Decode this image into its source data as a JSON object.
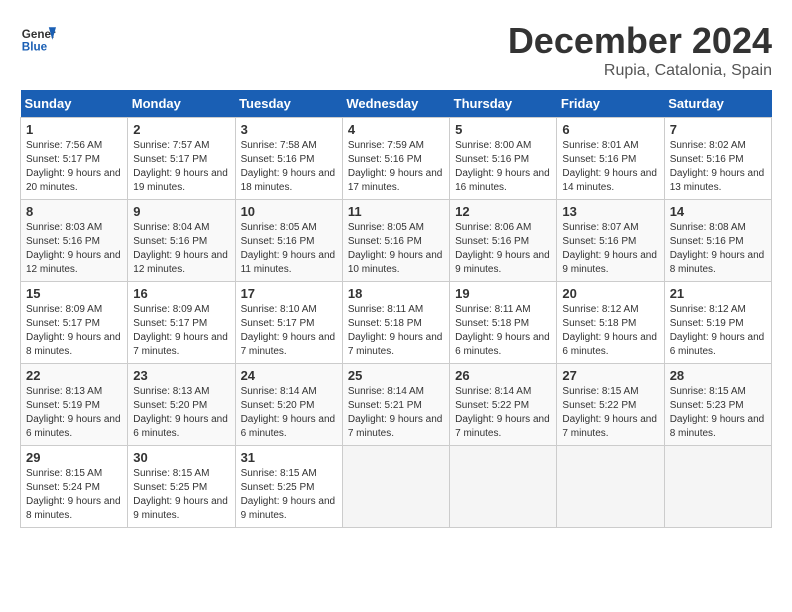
{
  "header": {
    "logo_line1": "General",
    "logo_line2": "Blue",
    "month": "December 2024",
    "location": "Rupia, Catalonia, Spain"
  },
  "weekdays": [
    "Sunday",
    "Monday",
    "Tuesday",
    "Wednesday",
    "Thursday",
    "Friday",
    "Saturday"
  ],
  "weeks": [
    [
      {
        "day": 1,
        "rise": "7:56 AM",
        "set": "5:17 PM",
        "daylight": "9 hours and 20 minutes"
      },
      {
        "day": 2,
        "rise": "7:57 AM",
        "set": "5:17 PM",
        "daylight": "9 hours and 19 minutes"
      },
      {
        "day": 3,
        "rise": "7:58 AM",
        "set": "5:16 PM",
        "daylight": "9 hours and 18 minutes"
      },
      {
        "day": 4,
        "rise": "7:59 AM",
        "set": "5:16 PM",
        "daylight": "9 hours and 17 minutes"
      },
      {
        "day": 5,
        "rise": "8:00 AM",
        "set": "5:16 PM",
        "daylight": "9 hours and 16 minutes"
      },
      {
        "day": 6,
        "rise": "8:01 AM",
        "set": "5:16 PM",
        "daylight": "9 hours and 14 minutes"
      },
      {
        "day": 7,
        "rise": "8:02 AM",
        "set": "5:16 PM",
        "daylight": "9 hours and 13 minutes"
      }
    ],
    [
      {
        "day": 8,
        "rise": "8:03 AM",
        "set": "5:16 PM",
        "daylight": "9 hours and 12 minutes"
      },
      {
        "day": 9,
        "rise": "8:04 AM",
        "set": "5:16 PM",
        "daylight": "9 hours and 12 minutes"
      },
      {
        "day": 10,
        "rise": "8:05 AM",
        "set": "5:16 PM",
        "daylight": "9 hours and 11 minutes"
      },
      {
        "day": 11,
        "rise": "8:05 AM",
        "set": "5:16 PM",
        "daylight": "9 hours and 10 minutes"
      },
      {
        "day": 12,
        "rise": "8:06 AM",
        "set": "5:16 PM",
        "daylight": "9 hours and 9 minutes"
      },
      {
        "day": 13,
        "rise": "8:07 AM",
        "set": "5:16 PM",
        "daylight": "9 hours and 9 minutes"
      },
      {
        "day": 14,
        "rise": "8:08 AM",
        "set": "5:16 PM",
        "daylight": "9 hours and 8 minutes"
      }
    ],
    [
      {
        "day": 15,
        "rise": "8:09 AM",
        "set": "5:17 PM",
        "daylight": "9 hours and 8 minutes"
      },
      {
        "day": 16,
        "rise": "8:09 AM",
        "set": "5:17 PM",
        "daylight": "9 hours and 7 minutes"
      },
      {
        "day": 17,
        "rise": "8:10 AM",
        "set": "5:17 PM",
        "daylight": "9 hours and 7 minutes"
      },
      {
        "day": 18,
        "rise": "8:11 AM",
        "set": "5:18 PM",
        "daylight": "9 hours and 7 minutes"
      },
      {
        "day": 19,
        "rise": "8:11 AM",
        "set": "5:18 PM",
        "daylight": "9 hours and 6 minutes"
      },
      {
        "day": 20,
        "rise": "8:12 AM",
        "set": "5:18 PM",
        "daylight": "9 hours and 6 minutes"
      },
      {
        "day": 21,
        "rise": "8:12 AM",
        "set": "5:19 PM",
        "daylight": "9 hours and 6 minutes"
      }
    ],
    [
      {
        "day": 22,
        "rise": "8:13 AM",
        "set": "5:19 PM",
        "daylight": "9 hours and 6 minutes"
      },
      {
        "day": 23,
        "rise": "8:13 AM",
        "set": "5:20 PM",
        "daylight": "9 hours and 6 minutes"
      },
      {
        "day": 24,
        "rise": "8:14 AM",
        "set": "5:20 PM",
        "daylight": "9 hours and 6 minutes"
      },
      {
        "day": 25,
        "rise": "8:14 AM",
        "set": "5:21 PM",
        "daylight": "9 hours and 7 minutes"
      },
      {
        "day": 26,
        "rise": "8:14 AM",
        "set": "5:22 PM",
        "daylight": "9 hours and 7 minutes"
      },
      {
        "day": 27,
        "rise": "8:15 AM",
        "set": "5:22 PM",
        "daylight": "9 hours and 7 minutes"
      },
      {
        "day": 28,
        "rise": "8:15 AM",
        "set": "5:23 PM",
        "daylight": "9 hours and 8 minutes"
      }
    ],
    [
      {
        "day": 29,
        "rise": "8:15 AM",
        "set": "5:24 PM",
        "daylight": "9 hours and 8 minutes"
      },
      {
        "day": 30,
        "rise": "8:15 AM",
        "set": "5:25 PM",
        "daylight": "9 hours and 9 minutes"
      },
      {
        "day": 31,
        "rise": "8:15 AM",
        "set": "5:25 PM",
        "daylight": "9 hours and 9 minutes"
      },
      null,
      null,
      null,
      null
    ]
  ]
}
